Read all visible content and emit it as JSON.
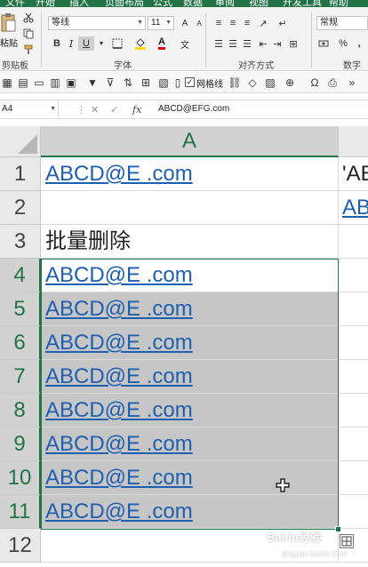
{
  "ribbon": {
    "tabs": [
      "文件",
      "开始",
      "插入",
      "页面布局",
      "公式",
      "数据",
      "审阅",
      "视图",
      "开发工具",
      "帮助"
    ],
    "clipboard": {
      "paste_label": "粘贴",
      "group_label": "剪贴板"
    },
    "font": {
      "font_name": "等线",
      "font_size": "11",
      "bold_label": "B",
      "italic_label": "I",
      "underline_label": "U",
      "font_color_label": "A",
      "grow_label": "A",
      "shrink_label": "A",
      "group_label": "字体"
    },
    "alignment": {
      "group_label": "对齐方式"
    },
    "number": {
      "format": "常规",
      "percent_label": "%",
      "comma_label": ",",
      "group_label": "数字"
    }
  },
  "qat": {
    "gridlines_label": "网格线",
    "gridlines_checked": "✓"
  },
  "formula_bar": {
    "name_box": "A4",
    "cancel_label": "✕",
    "enter_label": "✓",
    "fx_label": "fx",
    "content": "ABCD@EFG.com"
  },
  "grid": {
    "columns": [
      "A"
    ],
    "rows": [
      {
        "num": "1",
        "a": "ABCD@E   .com",
        "a_link": true,
        "b": "'AB"
      },
      {
        "num": "2",
        "a": "",
        "a_link": false,
        "b": "AB"
      },
      {
        "num": "3",
        "a": "批量删除",
        "a_link": false,
        "b": ""
      },
      {
        "num": "4",
        "a": "ABCD@E   .com",
        "a_link": true,
        "b": ""
      },
      {
        "num": "5",
        "a": "ABCD@E   .com",
        "a_link": true,
        "b": ""
      },
      {
        "num": "6",
        "a": "ABCD@E   .com",
        "a_link": true,
        "b": ""
      },
      {
        "num": "7",
        "a": "ABCD@E   .com",
        "a_link": true,
        "b": ""
      },
      {
        "num": "8",
        "a": "ABCD@E   .com",
        "a_link": true,
        "b": ""
      },
      {
        "num": "9",
        "a": "ABCD@E   .com",
        "a_link": true,
        "b": ""
      },
      {
        "num": "10",
        "a": "ABCD@E   .com",
        "a_link": true,
        "b": ""
      },
      {
        "num": "11",
        "a": "ABCD@E   .com",
        "a_link": true,
        "b": ""
      },
      {
        "num": "12",
        "a": "",
        "a_link": false,
        "b": ""
      }
    ]
  },
  "watermark": {
    "main": "Baidu经验",
    "sub": "jingyan.baidu.com"
  },
  "colors": {
    "accent": "#217346",
    "link": "#1f5fb0",
    "selection": "#c6c6c6"
  },
  "icons": {
    "paste": "clipboard-icon",
    "cut": "scissors-icon",
    "copy": "copy-icon",
    "format_painter": "brush-icon",
    "fill_color": "paint-bucket-icon",
    "cursor": "crosshair-plus-icon"
  }
}
